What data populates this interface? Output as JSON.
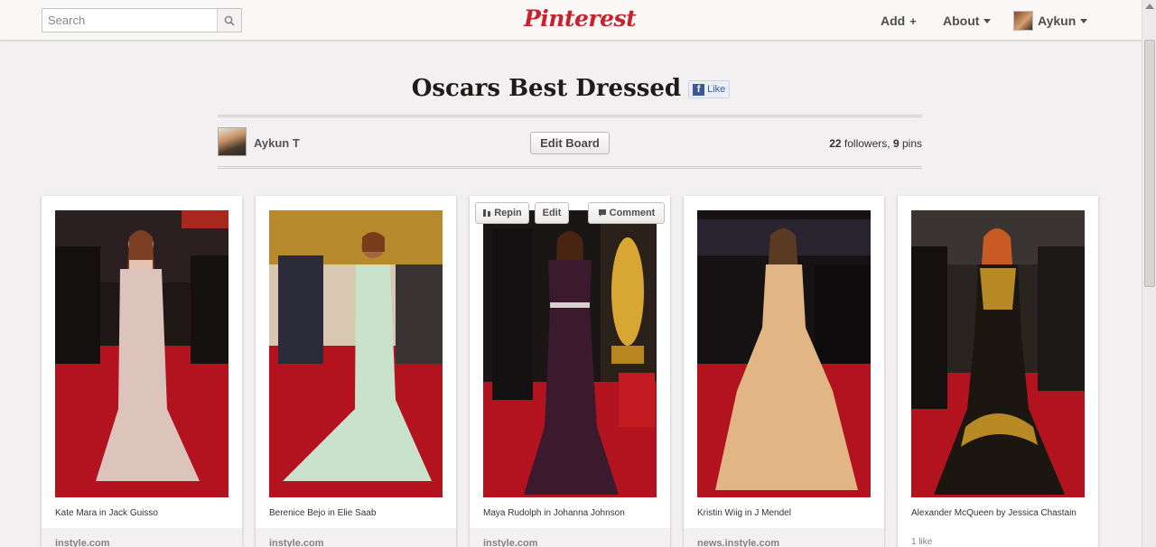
{
  "header": {
    "search_placeholder": "Search",
    "logo": "Pinterest",
    "nav": {
      "add": "Add",
      "add_symbol": "+",
      "about": "About",
      "user": "Aykun"
    }
  },
  "board": {
    "title": "Oscars Best Dressed",
    "fb_like_label": "Like",
    "fb_letter": "f",
    "owner": "Aykun T",
    "edit_button": "Edit Board",
    "followers_count": "22",
    "followers_label": "followers,",
    "pins_count": "9",
    "pins_label": "pins"
  },
  "pin_actions": {
    "repin": "Repin",
    "edit": "Edit",
    "comment": "Comment"
  },
  "pins": [
    {
      "caption": "Kate Mara in Jack Guisso",
      "source": "instyle.com",
      "dress_color": "#dcc3bc"
    },
    {
      "caption": "Berenice Bejo in Elie Saab",
      "source": "instyle.com",
      "dress_color": "#c8e2cc"
    },
    {
      "caption": "Maya Rudolph in Johanna Johnson",
      "source": "instyle.com",
      "dress_color": "#3a1a2c"
    },
    {
      "caption": "Kristin Wiig in J Mendel",
      "source": "news.instyle.com",
      "dress_color": "#e2b584"
    },
    {
      "caption": "Alexander McQueen by Jessica Chastain",
      "likes": "1 like",
      "dress_color": "#1c1610"
    }
  ],
  "colors": {
    "brand_red": "#c8232c",
    "carpet_red": "#b3121f",
    "facebook_blue": "#3b5998"
  }
}
